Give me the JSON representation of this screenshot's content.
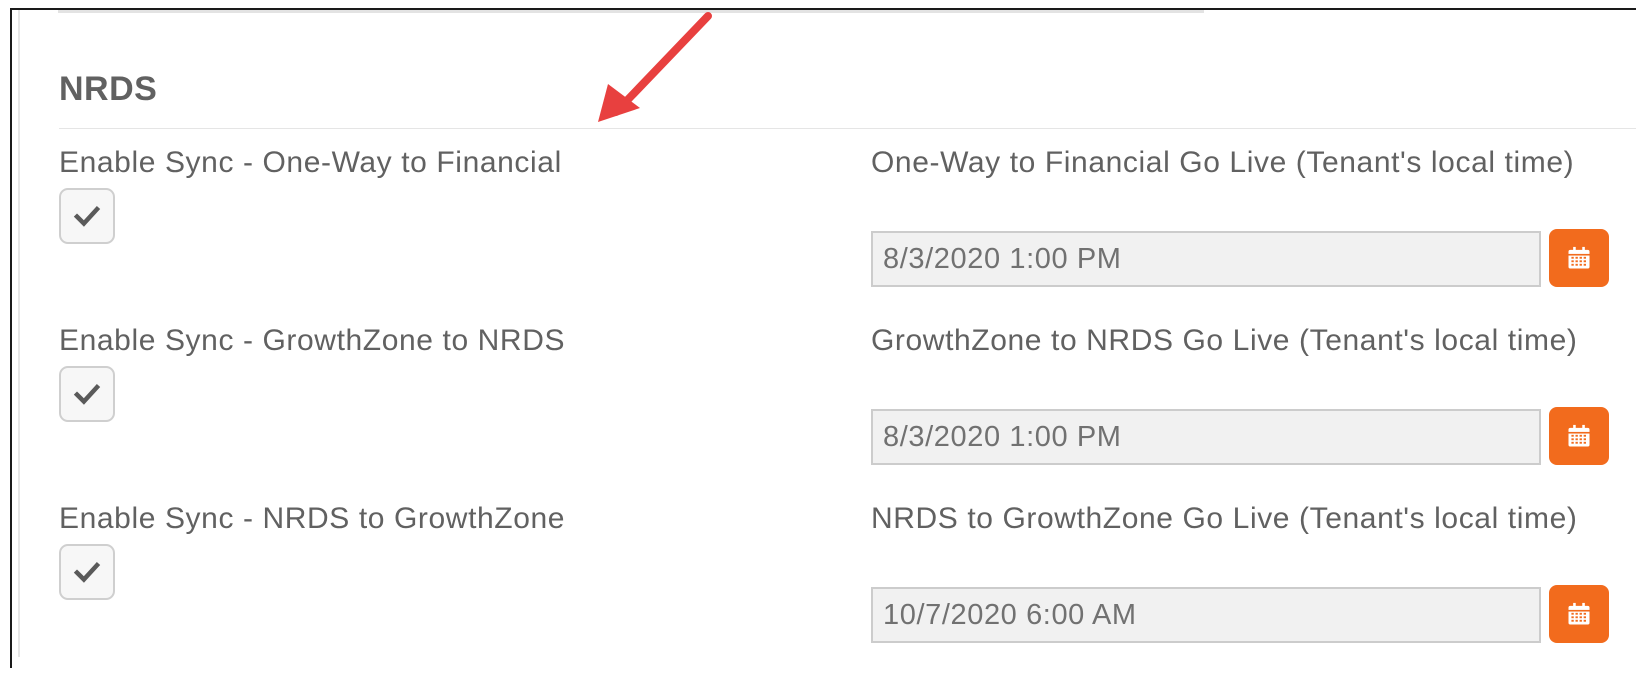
{
  "section": {
    "title": "NRDS"
  },
  "rows": [
    {
      "sync_label": "Enable Sync - One-Way to Financial",
      "checked": true,
      "golive_label": "One-Way to Financial Go Live (Tenant's local time)",
      "golive_value": "8/3/2020 1:00 PM"
    },
    {
      "sync_label": "Enable Sync - GrowthZone to NRDS",
      "checked": true,
      "golive_label": "GrowthZone to NRDS Go Live (Tenant's local time)",
      "golive_value": "8/3/2020 1:00 PM"
    },
    {
      "sync_label": "Enable Sync - NRDS to GrowthZone",
      "checked": true,
      "golive_label": "NRDS to GrowthZone Go Live (Tenant's local time)",
      "golive_value": "10/7/2020 6:00 AM"
    }
  ],
  "icons": {
    "checkbox": "checkmark-icon",
    "date_picker": "calendar-icon",
    "annotation": "red-arrow-icon"
  },
  "colors": {
    "accent": "#f26b1d",
    "annotation_arrow": "#e8403f",
    "text": "#616161"
  }
}
